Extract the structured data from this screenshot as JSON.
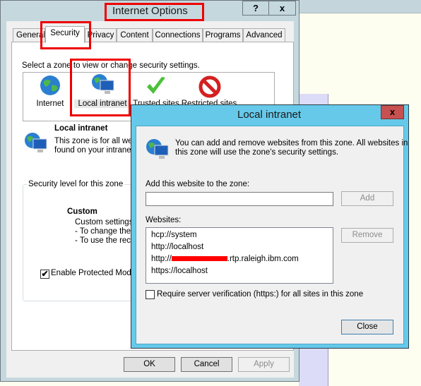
{
  "internet_options": {
    "title": "Internet Options",
    "help_button": "?",
    "close_button": "x",
    "tabs": [
      {
        "label": "General"
      },
      {
        "label": "Security"
      },
      {
        "label": "Privacy"
      },
      {
        "label": "Content"
      },
      {
        "label": "Connections"
      },
      {
        "label": "Programs"
      },
      {
        "label": "Advanced"
      }
    ],
    "selected_tab": "Security",
    "zone_prompt": "Select a zone to view or change security settings.",
    "zones": [
      {
        "label": "Internet",
        "icon": "globe-icon"
      },
      {
        "label": "Local intranet",
        "icon": "globe-computer-icon"
      },
      {
        "label": "Trusted sites",
        "icon": "green-check-icon"
      },
      {
        "label": "Restricted sites",
        "icon": "restricted-icon"
      }
    ],
    "selected_zone": "Local intranet",
    "zone_heading": "Local intranet",
    "zone_desc_line1": "This zone is for all websites that are",
    "zone_desc_line2": "found on your intranet.",
    "security_group_label": "Security level for this zone",
    "level_name": "Custom",
    "level_line1": "Custom settings.",
    "level_line2": "- To change the settings, click Custom level.",
    "level_line3": "- To use the recommended settings, click Default level.",
    "protected_mode_label": "Enable Protected Mode (requires restarting Internet Explorer)",
    "protected_mode_checked": true,
    "ok": "OK",
    "cancel": "Cancel",
    "apply": "Apply"
  },
  "local_intranet_dialog": {
    "title": "Local intranet",
    "close_button": "x",
    "description_line1": "You can add and remove websites from this zone. All websites in",
    "description_line2": "this zone will use the zone's security settings.",
    "add_label": "Add this website to the zone:",
    "add_input_value": "",
    "add_button": "Add",
    "websites_label": "Websites:",
    "websites": [
      "hcp://system",
      "http://localhost",
      "https://localhost"
    ],
    "redacted_site_prefix": "http://",
    "redacted_site_suffix": ".rtp.raleigh.ibm.com",
    "remove_button": "Remove",
    "require_https_label": "Require server verification (https:) for all sites in this zone",
    "require_https_checked": false,
    "close_label": "Close"
  },
  "colors": {
    "annotation_red": "#ee0000",
    "dialog_title": "#66c9ea",
    "close_red": "#c75050"
  }
}
